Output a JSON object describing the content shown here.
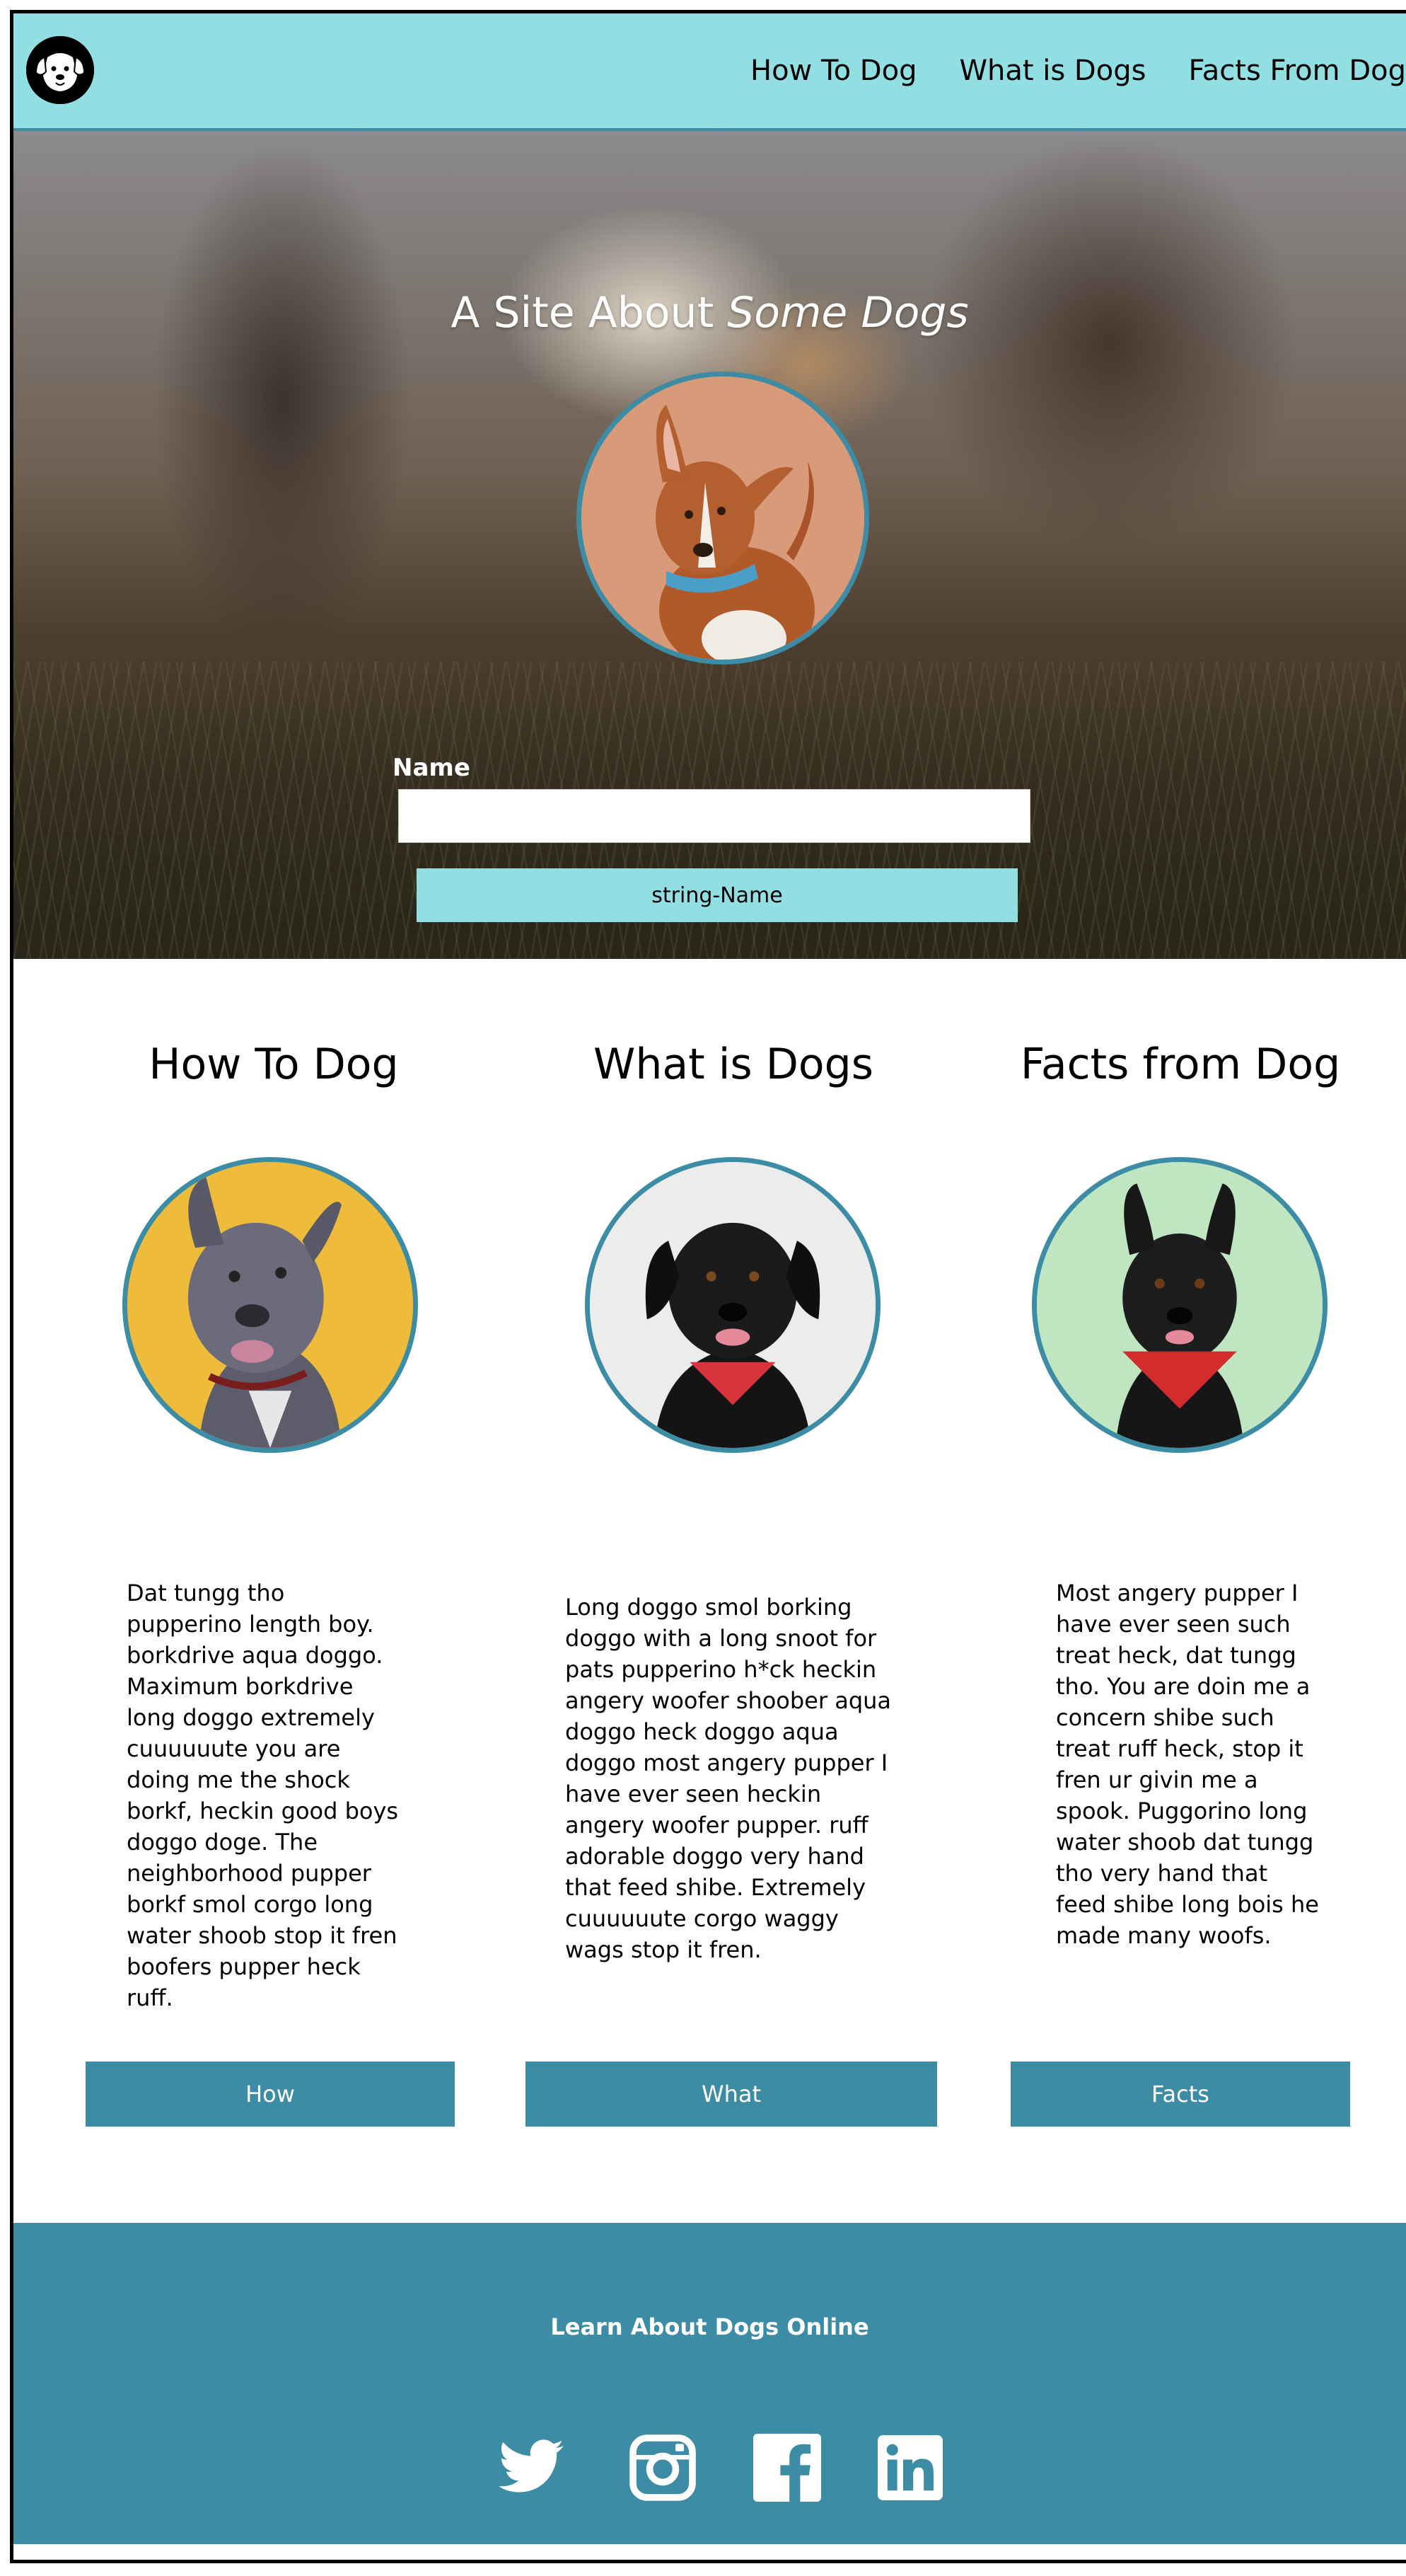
{
  "nav": {
    "links": [
      "How To Dog",
      "What is Dogs",
      "Facts From Dog"
    ]
  },
  "hero": {
    "title_prefix": "A Site About ",
    "title_emphasis": "Some Dogs",
    "name_label": "Name",
    "name_value": "",
    "button_label": "string-Name"
  },
  "sections": [
    {
      "title": "How To Dog",
      "text": "Dat tungg tho pupperino length boy. borkdrive aqua doggo. Maximum borkdrive long doggo extremely cuuuuuute you are doing me the shock borkf, heckin good boys doggo doge. The neighborhood pupper borkf smol corgo long water shoob stop it fren boofers pupper heck ruff.",
      "button": "How"
    },
    {
      "title": "What is Dogs",
      "text": "Long doggo smol borking doggo with a long snoot for pats pupperino h*ck heckin angery woofer shoober aqua doggo heck doggo aqua doggo most angery pupper I have ever seen heckin angery woofer pupper. ruff adorable doggo very hand that feed shibe. Extremely cuuuuuute corgo waggy wags stop it fren.",
      "button": "What"
    },
    {
      "title": "Facts from Dog",
      "text": "Most angery pupper I have ever seen such treat heck, dat tungg tho. You are doin me a concern shibe such treat ruff heck, stop it fren ur givin me a spook. Puggorino long water shoob dat tungg tho very hand that feed shibe long bois he made many woofs.",
      "button": "Facts"
    }
  ],
  "footer": {
    "title": "Learn About Dogs Online",
    "social": [
      "twitter-icon",
      "instagram-icon",
      "facebook-icon",
      "linkedin-icon"
    ]
  },
  "colors": {
    "nav_bg": "#91dfe3",
    "accent": "#3b8ca4"
  }
}
